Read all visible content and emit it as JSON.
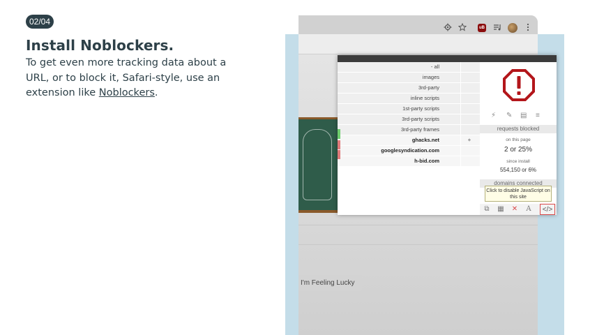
{
  "step": {
    "badge": "02/04",
    "title": "Install Noblockers.",
    "desc_prefix": "To get even more tracking data about a URL, or to block it, Safari-style, use an extension like ",
    "link_text": "Noblockers",
    "desc_suffix": "."
  },
  "browser": {
    "toolbar_icons": [
      "location-icon",
      "star-icon",
      "ublock-icon",
      "playlist-icon",
      "avatar-icon",
      "kebab-menu-icon"
    ],
    "ublock_badge": "uB",
    "lucky_button": "I'm Feeling Lucky"
  },
  "popup": {
    "rows": [
      {
        "label": "- all",
        "mark": ""
      },
      {
        "label": "images",
        "mark": ""
      },
      {
        "label": "3rd-party",
        "mark": ""
      },
      {
        "label": "inline scripts",
        "mark": ""
      },
      {
        "label": "1st-party scripts",
        "mark": ""
      },
      {
        "label": "3rd-party scripts",
        "mark": ""
      },
      {
        "label": "3rd-party frames",
        "mark": ""
      },
      {
        "label": "ghacks.net",
        "mark": "+"
      },
      {
        "label": "googlesyndication.com",
        "mark": "-"
      },
      {
        "label": "h-bid.com",
        "mark": "-"
      }
    ],
    "requests_blocked": "requests blocked",
    "on_this_page": "on this page",
    "page_value": "2 or 25%",
    "since_install": "since install",
    "install_value": "554,150 or 6%",
    "domains_connected": "domains connected",
    "tooltip": "Click to disable JavaScript on this site",
    "accent_color": "#b3161b"
  }
}
